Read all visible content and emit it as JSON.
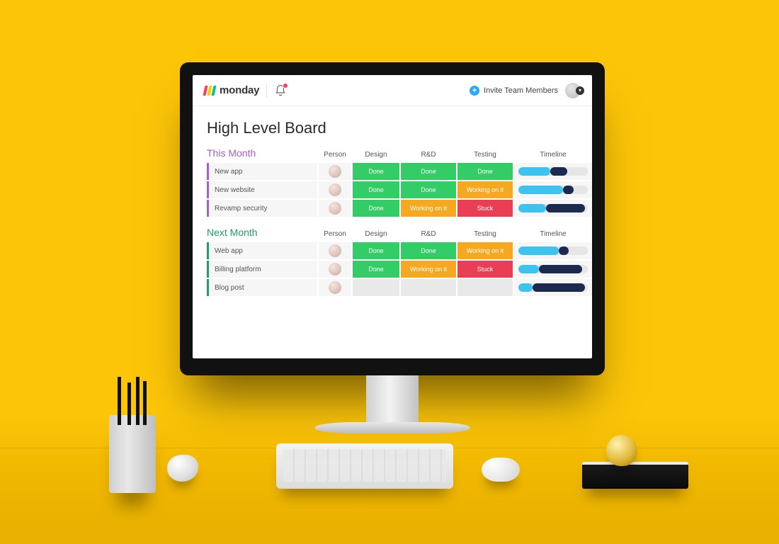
{
  "header": {
    "brand": "monday",
    "invite_label": "Invite Team Members"
  },
  "board": {
    "title": "High Level Board",
    "columns": [
      "Person",
      "Design",
      "R&D",
      "Testing",
      "Timeline"
    ],
    "status_colors": {
      "Done": "#33cc66",
      "Working on it": "#f6a821",
      "Stuck": "#ea3e54"
    },
    "timeline_colors": {
      "a": "#3ec2ef",
      "b": "#1b2a4e"
    },
    "groups": [
      {
        "name": "This Month",
        "accent": "purple",
        "rows": [
          {
            "task": "New app",
            "cells": [
              "Done",
              "Done",
              "Done"
            ],
            "timeline": {
              "a": [
                0,
                46
              ],
              "b": [
                46,
                70
              ]
            }
          },
          {
            "task": "New website",
            "cells": [
              "Done",
              "Done",
              "Working on it"
            ],
            "timeline": {
              "a": [
                0,
                64
              ],
              "b": [
                64,
                80
              ]
            }
          },
          {
            "task": "Revamp security",
            "cells": [
              "Done",
              "Working on it",
              "Stuck"
            ],
            "timeline": {
              "a": [
                0,
                40
              ],
              "b": [
                40,
                96
              ]
            }
          }
        ]
      },
      {
        "name": "Next Month",
        "accent": "green",
        "rows": [
          {
            "task": "Web app",
            "cells": [
              "Done",
              "Done",
              "Working on it"
            ],
            "timeline": {
              "a": [
                0,
                58
              ],
              "b": [
                58,
                72
              ]
            }
          },
          {
            "task": "Billing platform",
            "cells": [
              "Done",
              "Working on it",
              "Stuck"
            ],
            "timeline": {
              "a": [
                0,
                30
              ],
              "b": [
                30,
                92
              ]
            }
          },
          {
            "task": "Blog post",
            "cells": [
              "",
              "",
              ""
            ],
            "timeline": {
              "a": [
                0,
                20
              ],
              "b": [
                20,
                96
              ]
            }
          }
        ]
      }
    ]
  }
}
